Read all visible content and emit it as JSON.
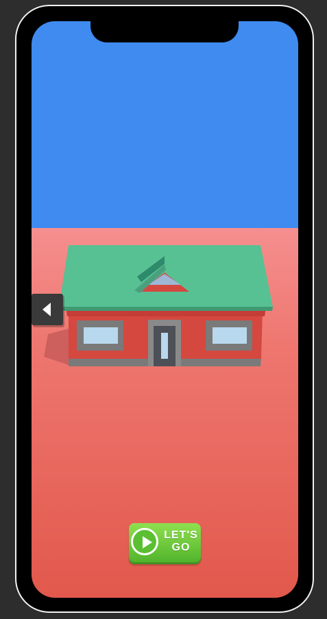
{
  "scene": {
    "sky_color": "#3f8bf0",
    "ground_color": "#e2584c",
    "house": {
      "roof_color": "#58c193",
      "wall_color": "#d4483f",
      "trim_color": "#7a7a7a",
      "window_color": "#b8d8ee"
    }
  },
  "controls": {
    "back_icon": "chevron-left-icon",
    "play_icon": "play-icon",
    "lets_go_label": "LET'S\nGO",
    "accent_color": "#5bbf32"
  }
}
